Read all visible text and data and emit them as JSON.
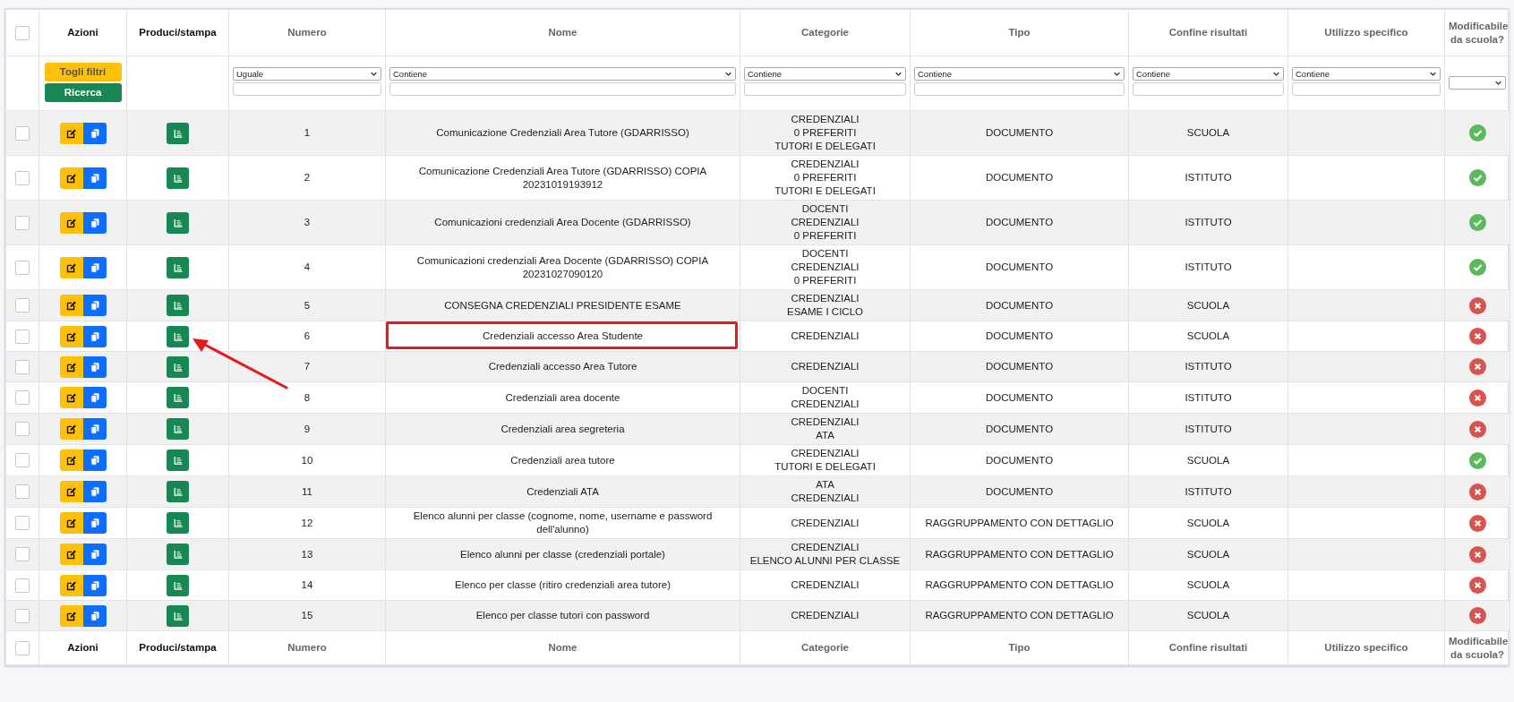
{
  "header_checkbox": {
    "checked": false
  },
  "columns": [
    {
      "label": "Azioni",
      "sortable": false
    },
    {
      "label": "Produci/stampa",
      "sortable": false
    },
    {
      "label": "Numero",
      "sortable": true,
      "filter": {
        "kind": "operator",
        "operator": "Uguale"
      }
    },
    {
      "label": "Nome",
      "sortable": true,
      "filter": {
        "kind": "operator",
        "operator": "Contiene"
      }
    },
    {
      "label": "Categorie",
      "sortable": true,
      "filter": {
        "kind": "operator",
        "operator": "Contiene"
      }
    },
    {
      "label": "Tipo",
      "sortable": true,
      "filter": {
        "kind": "operator",
        "operator": "Contiene"
      }
    },
    {
      "label": "Confine risultati",
      "sortable": true,
      "filter": {
        "kind": "operator",
        "operator": "Contiene"
      }
    },
    {
      "label": "Utilizzo specifico",
      "sortable": true,
      "filter": {
        "kind": "operator",
        "operator": "Contiene"
      }
    },
    {
      "label": "Modificabile da scuola?",
      "sortable": true,
      "filter": {
        "kind": "choice"
      }
    }
  ],
  "filter_buttons": [
    "Togli filtri",
    "Ricerca"
  ],
  "rows": [
    {
      "checked": false,
      "numero": "1",
      "nome": "Comunicazione Credenziali Area Tutore (GDARRISSO)",
      "categorie": [
        "CREDENZIALI",
        "0 PREFERITI",
        "TUTORI E DELEGATI"
      ],
      "tipo": "DOCUMENTO",
      "confine": "SCUOLA",
      "editable": true,
      "highlighted": false,
      "arrow": false
    },
    {
      "checked": false,
      "numero": "2",
      "nome": "Comunicazione Credenziali Area Tutore (GDARRISSO) COPIA 20231019193912",
      "categorie": [
        "CREDENZIALI",
        "0 PREFERITI",
        "TUTORI E DELEGATI"
      ],
      "tipo": "DOCUMENTO",
      "confine": "ISTITUTO",
      "editable": true,
      "highlighted": false,
      "arrow": false
    },
    {
      "checked": false,
      "numero": "3",
      "nome": "Comunicazioni credenziali Area Docente (GDARRISSO)",
      "categorie": [
        "DOCENTI",
        "CREDENZIALI",
        "0 PREFERITI"
      ],
      "tipo": "DOCUMENTO",
      "confine": "ISTITUTO",
      "editable": true,
      "highlighted": false,
      "arrow": false
    },
    {
      "checked": false,
      "numero": "4",
      "nome": "Comunicazioni credenziali Area Docente (GDARRISSO) COPIA 20231027090120",
      "categorie": [
        "DOCENTI",
        "CREDENZIALI",
        "0 PREFERITI"
      ],
      "tipo": "DOCUMENTO",
      "confine": "ISTITUTO",
      "editable": true,
      "highlighted": false,
      "arrow": false
    },
    {
      "checked": false,
      "numero": "5",
      "nome": "CONSEGNA CREDENZIALI PRESIDENTE ESAME",
      "categorie": [
        "CREDENZIALI",
        "ESAME I CICLO"
      ],
      "tipo": "DOCUMENTO",
      "confine": "SCUOLA",
      "editable": false,
      "highlighted": false,
      "arrow": false
    },
    {
      "checked": false,
      "numero": "6",
      "nome": "Credenziali accesso Area Studente",
      "categorie": [
        "CREDENZIALI"
      ],
      "tipo": "DOCUMENTO",
      "confine": "SCUOLA",
      "editable": false,
      "highlighted": true,
      "arrow": true
    },
    {
      "checked": false,
      "numero": "7",
      "nome": "Credenziali accesso Area Tutore",
      "categorie": [
        "CREDENZIALI"
      ],
      "tipo": "DOCUMENTO",
      "confine": "ISTITUTO",
      "editable": false,
      "highlighted": false,
      "arrow": false
    },
    {
      "checked": false,
      "numero": "8",
      "nome": "Credenziali area docente",
      "categorie": [
        "DOCENTI",
        "CREDENZIALI"
      ],
      "tipo": "DOCUMENTO",
      "confine": "ISTITUTO",
      "editable": false,
      "highlighted": false,
      "arrow": false
    },
    {
      "checked": false,
      "numero": "9",
      "nome": "Credenziali area segreteria",
      "categorie": [
        "CREDENZIALI",
        "ATA"
      ],
      "tipo": "DOCUMENTO",
      "confine": "ISTITUTO",
      "editable": false,
      "highlighted": false,
      "arrow": false
    },
    {
      "checked": false,
      "numero": "10",
      "nome": "Credenziali area tutore",
      "categorie": [
        "CREDENZIALI",
        "TUTORI E DELEGATI"
      ],
      "tipo": "DOCUMENTO",
      "confine": "SCUOLA",
      "editable": true,
      "highlighted": false,
      "arrow": false
    },
    {
      "checked": false,
      "numero": "11",
      "nome": "Credenziali ATA",
      "categorie": [
        "ATA",
        "CREDENZIALI"
      ],
      "tipo": "DOCUMENTO",
      "confine": "ISTITUTO",
      "editable": false,
      "highlighted": false,
      "arrow": false
    },
    {
      "checked": false,
      "numero": "12",
      "nome": "Elenco alunni per classe (cognome, nome, username e password dell'alunno)",
      "categorie": [
        "CREDENZIALI"
      ],
      "tipo": "RAGGRUPPAMENTO CON DETTAGLIO",
      "confine": "SCUOLA",
      "editable": false,
      "highlighted": false,
      "arrow": false
    },
    {
      "checked": false,
      "numero": "13",
      "nome": "Elenco alunni per classe (credenziali portale)",
      "categorie": [
        "CREDENZIALI",
        "ELENCO ALUNNI PER CLASSE"
      ],
      "tipo": "RAGGRUPPAMENTO CON DETTAGLIO",
      "confine": "SCUOLA",
      "editable": false,
      "highlighted": false,
      "arrow": false
    },
    {
      "checked": false,
      "numero": "14",
      "nome": "Elenco per classe (ritiro credenziali area tutore)",
      "categorie": [
        "CREDENZIALI"
      ],
      "tipo": "RAGGRUPPAMENTO CON DETTAGLIO",
      "confine": "SCUOLA",
      "editable": false,
      "highlighted": false,
      "arrow": false
    },
    {
      "checked": false,
      "numero": "15",
      "nome": "Elenco per classe tutori con password",
      "categorie": [
        "CREDENZIALI"
      ],
      "tipo": "RAGGRUPPAMENTO CON DETTAGLIO",
      "confine": "SCUOLA",
      "editable": false,
      "highlighted": false,
      "arrow": false
    }
  ],
  "footer_checkbox": {
    "checked": false
  },
  "footer_columns": [
    {
      "label": "Azioni",
      "sortable": false
    },
    {
      "label": "Produci/stampa",
      "sortable": false
    },
    {
      "label": "Numero",
      "sortable": true
    },
    {
      "label": "Nome",
      "sortable": true
    },
    {
      "label": "Categorie",
      "sortable": true
    },
    {
      "label": "Tipo",
      "sortable": true
    },
    {
      "label": "Confine risultati",
      "sortable": true
    },
    {
      "label": "Utilizzo specifico",
      "sortable": true
    },
    {
      "label": "Modificabile da scuola?",
      "sortable": true
    }
  ]
}
